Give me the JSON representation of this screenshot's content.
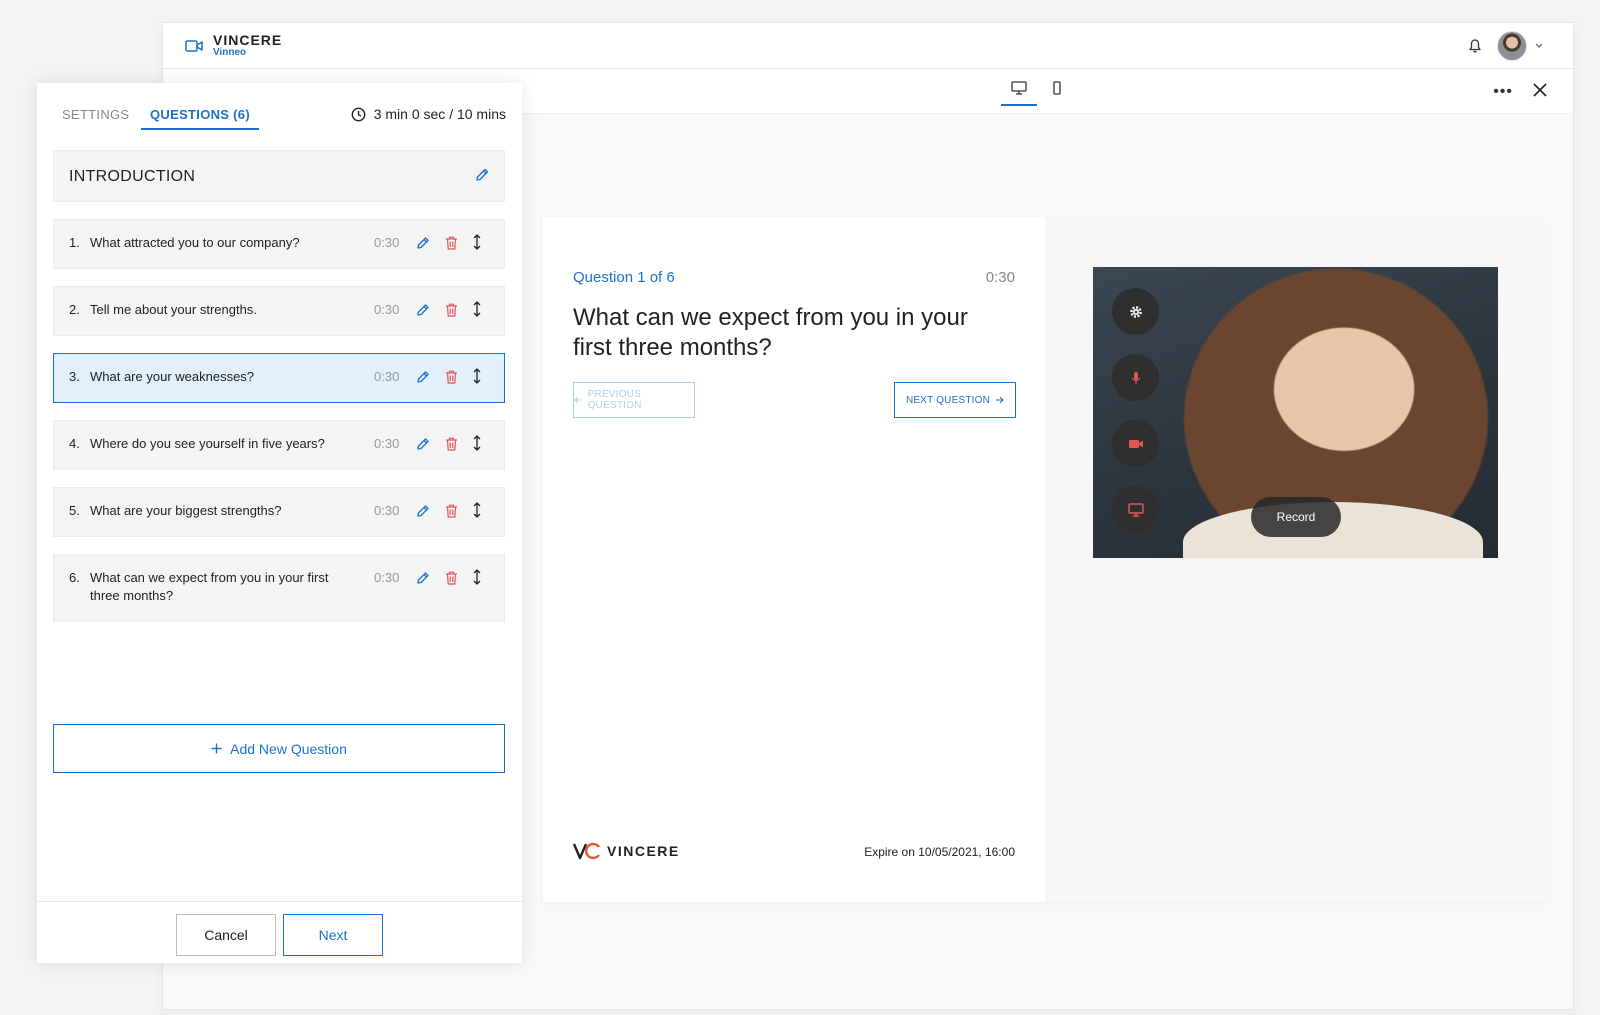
{
  "app": {
    "brand_name": "VINCERE",
    "brand_sub": "Vinneo"
  },
  "panel": {
    "tabs": [
      {
        "label": "SETTINGS",
        "active": false
      },
      {
        "label": "QUESTIONS (6)",
        "active": true
      }
    ],
    "timer": "3 min 0 sec / 10 mins",
    "introduction_label": "INTRODUCTION",
    "questions": [
      {
        "num": "1.",
        "text": "What attracted you to our company?",
        "duration": "0:30",
        "active": false
      },
      {
        "num": "2.",
        "text": "Tell me about your strengths.",
        "duration": "0:30",
        "active": false
      },
      {
        "num": "3.",
        "text": "What are your weaknesses?",
        "duration": "0:30",
        "active": true
      },
      {
        "num": "4.",
        "text": "Where do you see yourself in five years?",
        "duration": "0:30",
        "active": false
      },
      {
        "num": "5.",
        "text": "What are your biggest strengths?",
        "duration": "0:30",
        "active": false
      },
      {
        "num": "6.",
        "text": "What can we expect from you in your first three months?",
        "duration": "0:30",
        "active": false
      }
    ],
    "add_question_label": "Add New Question",
    "cancel_label": "Cancel",
    "next_label": "Next"
  },
  "preview": {
    "question_counter": "Question 1 of 6",
    "question_time": "0:30",
    "question_text": "What can we expect from you in your first three months?",
    "prev_label": "PREVIOUS QUESTION",
    "next_label": "NEXT QUESTION",
    "footer_brand": "VINCERE",
    "expire_text": "Expire on 10/05/2021, 16:00",
    "record_label": "Record"
  },
  "colors": {
    "accent": "#1a73c9",
    "delete": "#e05656",
    "active_row": "#e1f0fb"
  },
  "icons": [
    "video-camera-icon",
    "bell-icon",
    "chevron-down-icon",
    "desktop-icon",
    "mobile-icon",
    "more-icon",
    "close-icon",
    "clock-icon",
    "pencil-icon",
    "trash-icon",
    "reorder-icon",
    "plus-icon",
    "arrow-left-icon",
    "arrow-right-icon",
    "gear-icon",
    "microphone-icon",
    "camera-icon",
    "screen-share-icon"
  ]
}
